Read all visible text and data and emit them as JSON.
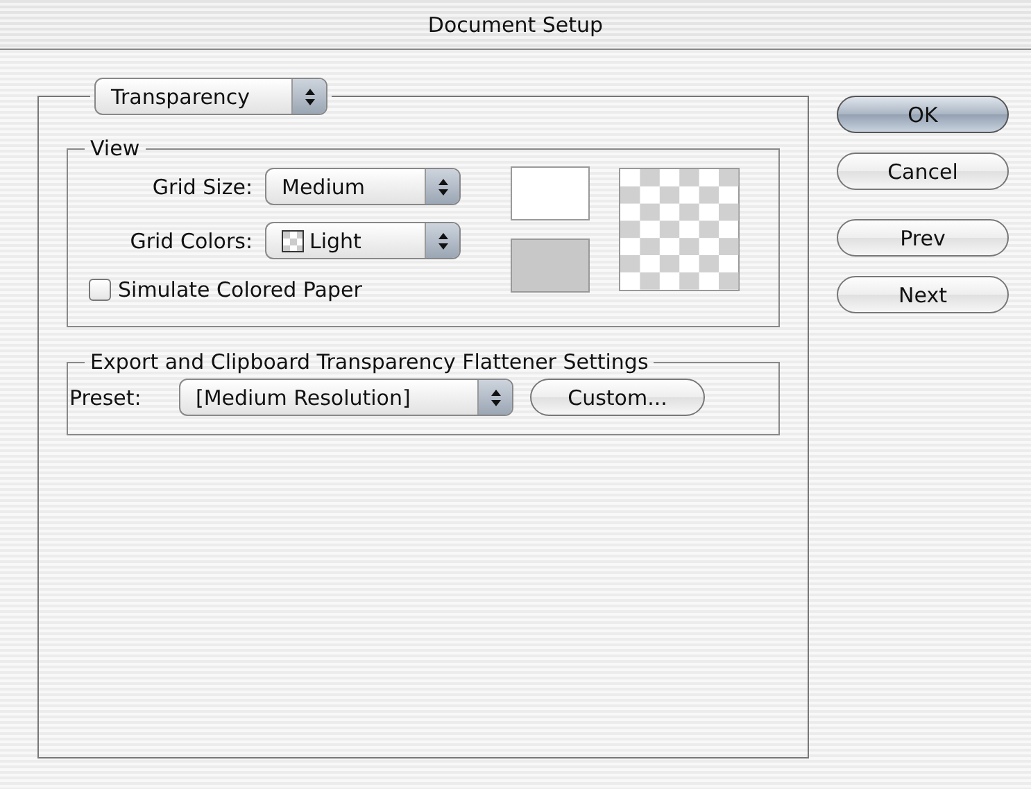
{
  "window": {
    "title": "Document Setup"
  },
  "section_popup": {
    "value": "Transparency"
  },
  "view": {
    "title": "View",
    "grid_size": {
      "label": "Grid Size:",
      "value": "Medium"
    },
    "grid_colors": {
      "label": "Grid Colors:",
      "value": "Light"
    },
    "simulate_paper": {
      "label": "Simulate Colored Paper",
      "checked": false
    },
    "swatches": [
      {
        "color": "#ffffff"
      },
      {
        "color": "#c8c8c8"
      }
    ]
  },
  "export": {
    "title": "Export and Clipboard Transparency Flattener Settings",
    "preset": {
      "label": "Preset:",
      "value": "[Medium Resolution]"
    },
    "custom_button": "Custom..."
  },
  "buttons": [
    {
      "label": "OK",
      "default": true
    },
    {
      "label": "Cancel",
      "default": false
    },
    {
      "label": "Prev",
      "default": false
    },
    {
      "label": "Next",
      "default": false
    }
  ]
}
